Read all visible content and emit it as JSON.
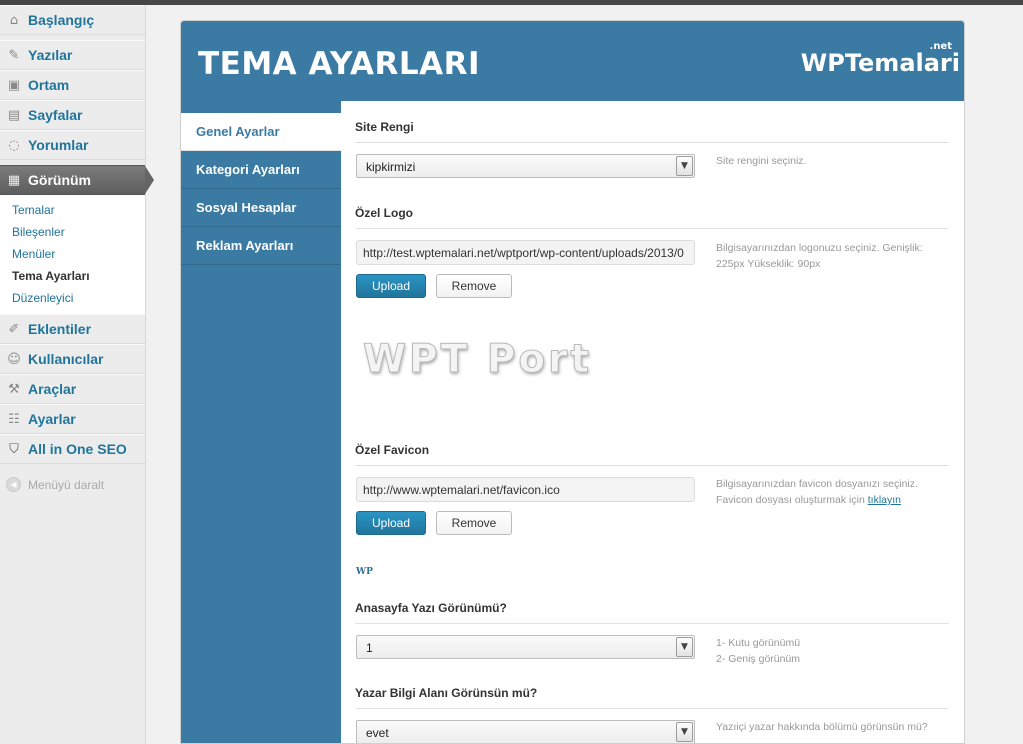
{
  "admin_menu": {
    "items": [
      {
        "label": "Başlangıç",
        "icon": "home-icon"
      },
      {
        "label": "Yazılar",
        "icon": "pin-icon"
      },
      {
        "label": "Ortam",
        "icon": "media-icon"
      },
      {
        "label": "Sayfalar",
        "icon": "pages-icon"
      },
      {
        "label": "Yorumlar",
        "icon": "comments-icon"
      },
      {
        "label": "Görünüm",
        "icon": "appearance-icon",
        "active": true
      },
      {
        "label": "Eklentiler",
        "icon": "plugin-icon"
      },
      {
        "label": "Kullanıcılar",
        "icon": "users-icon"
      },
      {
        "label": "Araçlar",
        "icon": "tools-icon"
      },
      {
        "label": "Ayarlar",
        "icon": "settings-icon"
      },
      {
        "label": "All in One SEO",
        "icon": "shield-icon"
      }
    ],
    "submenu": [
      "Temalar",
      "Bileşenler",
      "Menüler",
      "Tema Ayarları",
      "Düzenleyici"
    ],
    "current_submenu": "Tema Ayarları",
    "collapse_label": "Menüyü daralt"
  },
  "panel": {
    "title": "TEMA AYARLARI",
    "brand": "WPTemalari",
    "brand_suffix": ".net",
    "tabs": [
      "Genel Ayarlar",
      "Kategori Ayarları",
      "Sosyal Hesaplar",
      "Reklam Ayarları"
    ],
    "active_tab": "Genel Ayarlar"
  },
  "fields": {
    "site_color": {
      "label": "Site Rengi",
      "value": "kipkirmizi",
      "help": "Site rengini seçiniz."
    },
    "logo": {
      "label": "Özel Logo",
      "value": "http://test.wptemalari.net/wptport/wp-content/uploads/2013/0",
      "help": "Bilgisayarınızdan logonuzu seçiniz. Genişlik: 225px Yükseklik: 90px",
      "preview_text": "WPT Port",
      "upload_label": "Upload",
      "remove_label": "Remove"
    },
    "favicon": {
      "label": "Özel Favicon",
      "value": "http://www.wptemalari.net/favicon.ico",
      "help_text": "Bilgisayarınızdan favicon dosyanızı seçiniz. Favicon dosyası oluşturmak için",
      "help_link": "tıklayın",
      "preview_text": "WP",
      "upload_label": "Upload",
      "remove_label": "Remove"
    },
    "home_view": {
      "label": "Anasayfa Yazı Görünümü?",
      "value": "1",
      "help_line1": "1- Kutu görünümü",
      "help_line2": "2- Geniş görünüm"
    },
    "author_box": {
      "label": "Yazar Bilgi Alanı Görünsün mü?",
      "value": "evet",
      "help": "Yazıiçi yazar hakkında bölümü görünsün mü?"
    }
  },
  "colors": {
    "panel_blue": "#3b7aa3",
    "link_blue": "#21759b",
    "button_blue": "#21759b"
  }
}
